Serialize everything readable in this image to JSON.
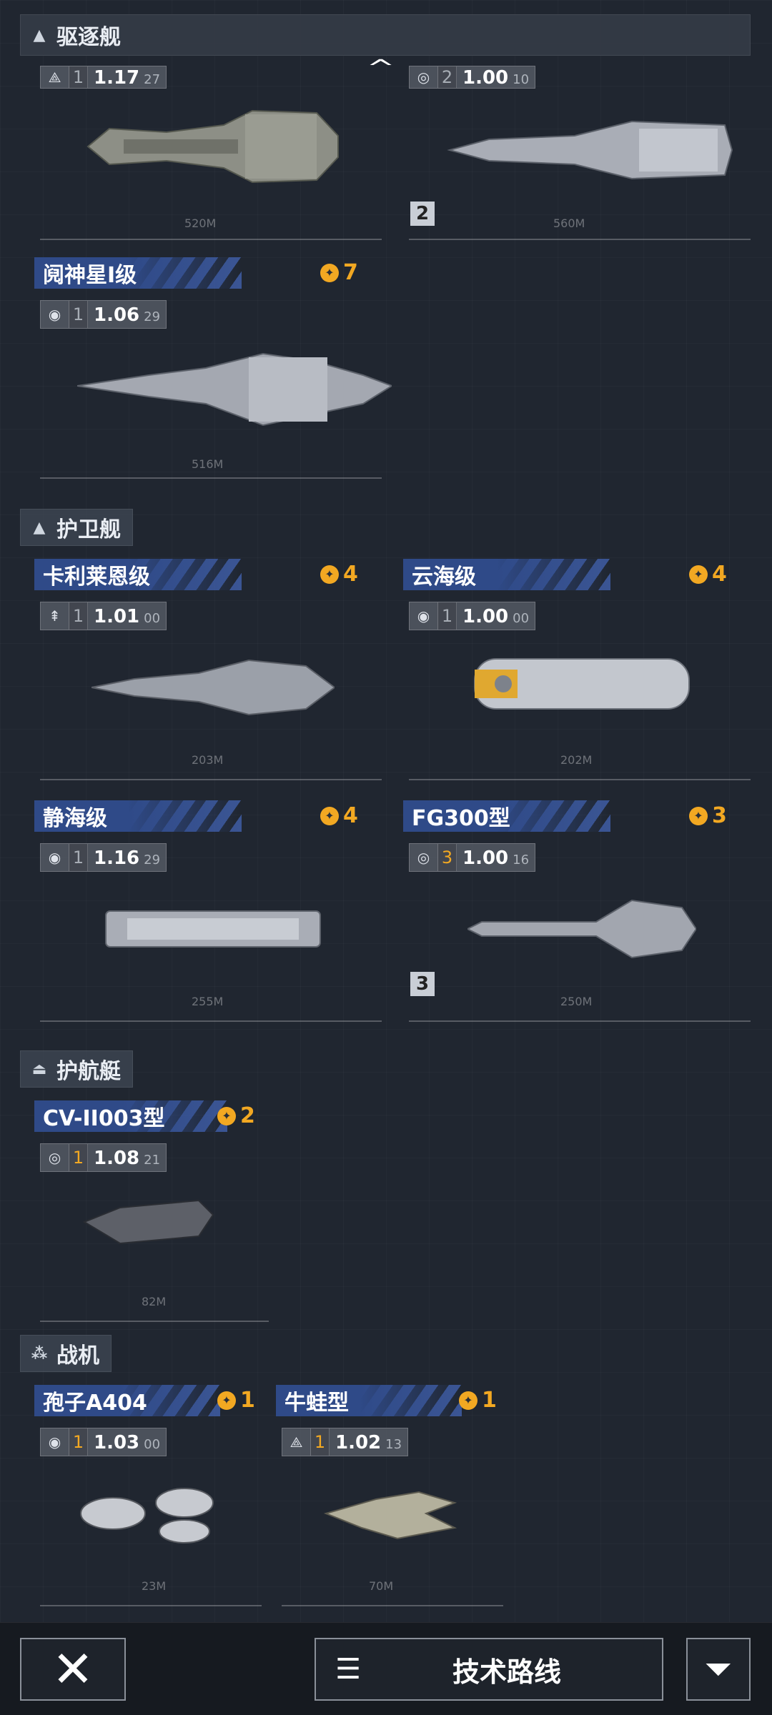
{
  "sections": {
    "destroyer": {
      "title": "驱逐舰"
    },
    "frigate": {
      "title": "护卫舰"
    },
    "corvette": {
      "title": "护航艇"
    },
    "fighter": {
      "title": "战机"
    }
  },
  "top_partial": {
    "left": {
      "rank": "1",
      "value": "1.17",
      "sub": "27",
      "length": "520M"
    },
    "right": {
      "rank": "2",
      "value": "1.00",
      "sub": "10",
      "length": "560M",
      "tier": "2"
    }
  },
  "cards": {
    "yueshen": {
      "name": "阋神星Ⅰ级",
      "cost": "7",
      "rank": "1",
      "value": "1.06",
      "sub": "29",
      "length": "516M"
    },
    "kalilaien": {
      "name": "卡利莱恩级",
      "cost": "4",
      "rank": "1",
      "value": "1.01",
      "sub": "00",
      "length": "203M"
    },
    "yunhai": {
      "name": "云海级",
      "cost": "4",
      "rank": "1",
      "value": "1.00",
      "sub": "00",
      "length": "202M"
    },
    "jinghai": {
      "name": "静海级",
      "cost": "4",
      "rank": "1",
      "value": "1.16",
      "sub": "29",
      "length": "255M"
    },
    "fg300": {
      "name": "FG300型",
      "cost": "3",
      "rank": "3",
      "value": "1.00",
      "sub": "16",
      "length": "250M",
      "tier": "3"
    },
    "cv11003": {
      "name": "CV-II003型",
      "cost": "2",
      "rank": "1",
      "value": "1.08",
      "sub": "21",
      "length": "82M"
    },
    "baozi": {
      "name": "孢子A404",
      "cost": "1",
      "rank": "1",
      "value": "1.03",
      "sub": "00",
      "length": "23M"
    },
    "niuwa": {
      "name": "牛蛙型",
      "cost": "1",
      "rank": "1",
      "value": "1.02",
      "sub": "13",
      "length": "70M"
    }
  },
  "bottom": {
    "tech_label": "技术路线"
  },
  "colors": {
    "accent": "#f2a822",
    "name_bar": "#2f4a88",
    "background": "#202630"
  }
}
